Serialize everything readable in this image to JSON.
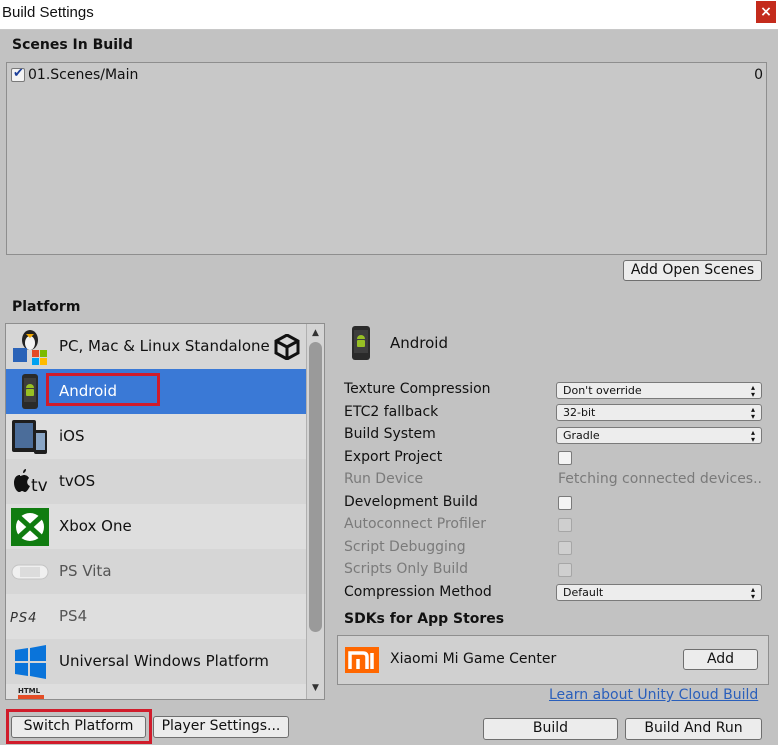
{
  "window": {
    "title": "Build Settings",
    "close": "×"
  },
  "scenes": {
    "header": "Scenes In Build",
    "items": [
      {
        "name": "01.Scenes/Main",
        "index": "0",
        "checked": true
      }
    ],
    "add_open_scenes": "Add Open Scenes"
  },
  "platform": {
    "header": "Platform",
    "items": [
      {
        "label": "PC, Mac & Linux Standalone",
        "icon": "pc-standalone-icon"
      },
      {
        "label": "Android",
        "icon": "android-icon",
        "selected": true
      },
      {
        "label": "iOS",
        "icon": "ios-devices-icon"
      },
      {
        "label": "tvOS",
        "icon": "appletv-icon"
      },
      {
        "label": "Xbox One",
        "icon": "xbox-icon"
      },
      {
        "label": "PS Vita",
        "icon": "psvita-icon"
      },
      {
        "label": "PS4",
        "icon": "ps4-icon"
      },
      {
        "label": "Universal Windows Platform",
        "icon": "windows-icon"
      }
    ],
    "partial_icon_text": "HTML"
  },
  "settings": {
    "platform_name": "Android",
    "rows": [
      {
        "label": "Texture Compression",
        "value": "Don't override"
      },
      {
        "label": "ETC2 fallback",
        "value": "32-bit"
      },
      {
        "label": "Build System",
        "value": "Gradle"
      },
      {
        "label": "Export Project"
      },
      {
        "label": "Run Device",
        "value": "Fetching connected devices.."
      },
      {
        "label": "Development Build"
      },
      {
        "label": "Autoconnect Profiler"
      },
      {
        "label": "Script Debugging"
      },
      {
        "label": "Scripts Only Build"
      },
      {
        "label": "Compression Method",
        "value": "Default"
      }
    ],
    "sdk_header": "SDKs for App Stores",
    "sdk_item": {
      "name": "Xiaomi Mi Game Center",
      "logo": "mi",
      "button": "Add"
    },
    "cloud_link": "Learn about Unity Cloud Build"
  },
  "buttons": {
    "switch_platform": "Switch Platform",
    "player_settings": "Player Settings...",
    "build": "Build",
    "build_and_run": "Build And Run"
  },
  "colors": {
    "selection": "#3a79d6",
    "highlight_border": "#d01c2b",
    "link": "#2a5fbb"
  }
}
